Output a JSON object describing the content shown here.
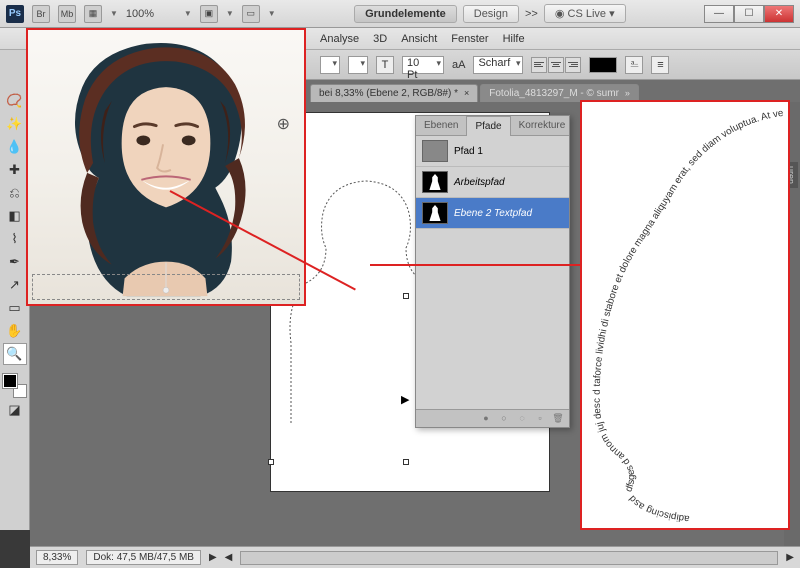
{
  "titlebar": {
    "ps": "Ps",
    "br": "Br",
    "mb": "Mb",
    "zoom": "100%",
    "wsA": "Grundelemente",
    "wsB": "Design",
    "more": ">>",
    "cslive": "CS Live"
  },
  "menu": {
    "analyse": "Analyse",
    "dd": "3D",
    "ansicht": "Ansicht",
    "fenster": "Fenster",
    "hilfe": "Hilfe"
  },
  "options": {
    "tool": "T",
    "size": "10 Pt",
    "aa_label": "aA",
    "aa": "Scharf"
  },
  "tabs": {
    "a": "bei 8,33% (Ebene 2, RGB/8#) *",
    "b": "Fotolia_4813297_M - © sumr"
  },
  "panel": {
    "t1": "Ebenen",
    "t2": "Pfade",
    "t3": "Korrekture",
    "r1": "Pfad 1",
    "r2": "Arbeitspfad",
    "r3": "Ebene 2 Textpfad"
  },
  "rc": {
    "tab": "uren"
  },
  "status": {
    "zoom": "8,33%",
    "doc": "Dok: 47,5 MB/47,5 MB"
  },
  "textpath": {
    "line": "adipiscing asd dfsges d annom juj desc d taforce lividhi di stabore et dolore magna aliquyam erat, sed diam voluptua. At vero eos et a"
  }
}
